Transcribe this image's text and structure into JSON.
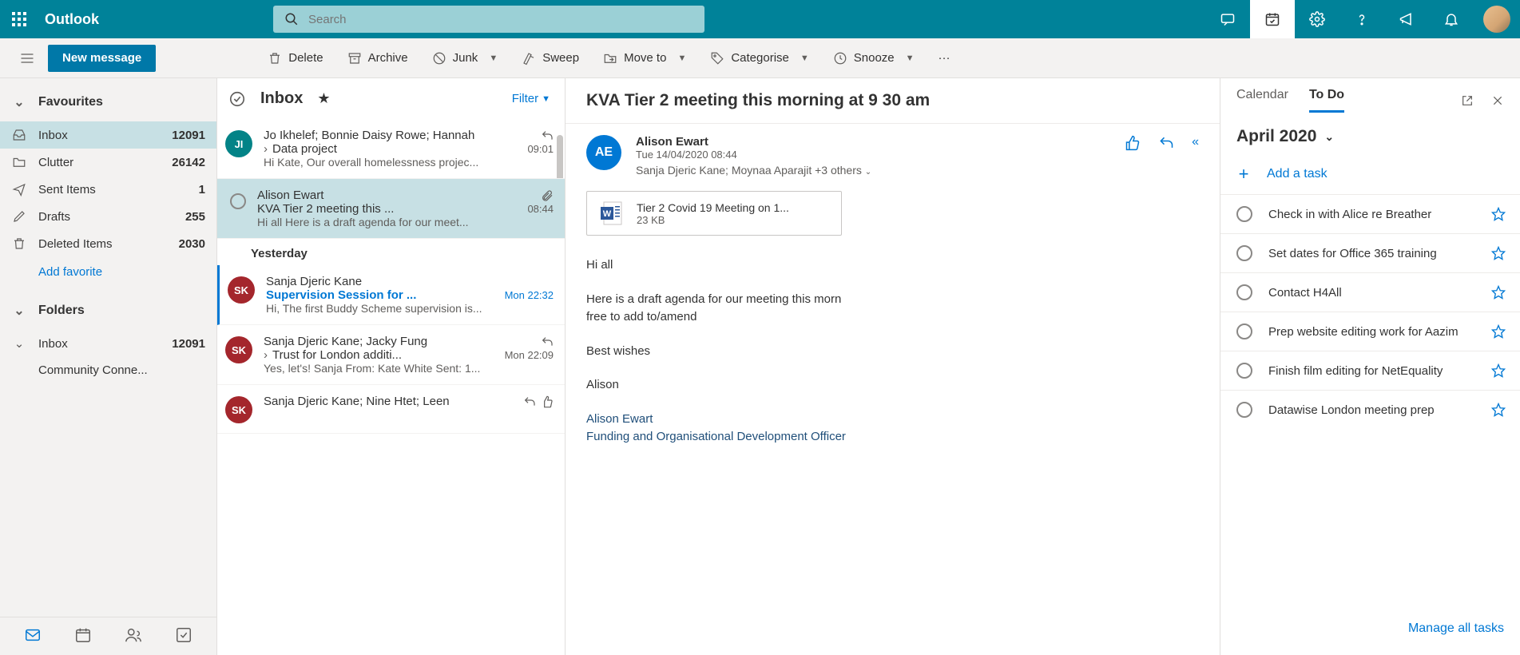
{
  "brand": "Outlook",
  "search": {
    "placeholder": "Search"
  },
  "newMessage": "New message",
  "cmdbar": {
    "delete": "Delete",
    "archive": "Archive",
    "junk": "Junk",
    "sweep": "Sweep",
    "moveTo": "Move to",
    "categorise": "Categorise",
    "snooze": "Snooze"
  },
  "nav": {
    "favourites": "Favourites",
    "folders": "Folders",
    "items": [
      {
        "label": "Inbox",
        "count": "12091"
      },
      {
        "label": "Clutter",
        "count": "26142"
      },
      {
        "label": "Sent Items",
        "count": "1"
      },
      {
        "label": "Drafts",
        "count": "255"
      },
      {
        "label": "Deleted Items",
        "count": "2030"
      }
    ],
    "addFavorite": "Add favorite",
    "inbox2": {
      "label": "Inbox",
      "count": "12091"
    },
    "community": "Community Conne..."
  },
  "list": {
    "title": "Inbox",
    "filter": "Filter",
    "yesterday": "Yesterday",
    "messages": [
      {
        "from": "Jo Ikhelef; Bonnie Daisy Rowe; Hannah",
        "subject": "Data project",
        "time": "09:01",
        "preview": "Hi Kate, Our overall homelessness projec...",
        "thread": true,
        "reply": true,
        "initials": "JI",
        "color": "#038387"
      },
      {
        "from": "Alison Ewart",
        "subject": "KVA Tier 2 meeting this ...",
        "time": "08:44",
        "preview": "Hi all Here is a draft agenda for our meet...",
        "attach": true,
        "selected": true
      },
      {
        "from": "Sanja Djeric Kane",
        "subject": "Supervision Session for ...",
        "time": "Mon 22:32",
        "preview": "Hi, The first Buddy Scheme supervision is...",
        "unread": true,
        "initials": "SK",
        "color": "#a4262c"
      },
      {
        "from": "Sanja Djeric Kane; Jacky Fung",
        "subject": "Trust for London additi...",
        "time": "Mon 22:09",
        "preview": "Yes, let's! Sanja From: Kate White Sent: 1...",
        "thread": true,
        "reply": true,
        "initials": "SK",
        "color": "#a4262c"
      },
      {
        "from": "Sanja Djeric Kane; Nine Htet; Leen",
        "subject": "",
        "time": "",
        "preview": "",
        "reply": true,
        "like": true,
        "initials": "SK",
        "color": "#a4262c",
        "partial": true
      }
    ]
  },
  "reading": {
    "subject": "KVA Tier 2 meeting this morning at 9 30 am",
    "fromName": "Alison Ewart",
    "fromInitials": "AE",
    "date": "Tue 14/04/2020 08:44",
    "to": "Sanja Djeric Kane; Moynaa Aparajit +3 others",
    "attachment": {
      "name": "Tier 2 Covid 19 Meeting on 1...",
      "size": "23 KB"
    },
    "body": {
      "greeting": "Hi all",
      "line1": "Here is a draft agenda for our meeting this morn",
      "line2": "free to add to/amend",
      "closing": "Best wishes",
      "name": "Alison",
      "sigName": "Alison Ewart",
      "sigTitle": "Funding and Organisational Development Officer"
    }
  },
  "todo": {
    "tabs": {
      "calendar": "Calendar",
      "todo": "To Do"
    },
    "month": "April 2020",
    "addTask": "Add a task",
    "tasks": [
      "Check in with Alice re Breather",
      "Set dates for Office 365 training",
      "Contact H4All",
      "Prep website editing work for Aazim",
      "Finish film editing for NetEquality",
      "Datawise London meeting prep"
    ],
    "manage": "Manage all tasks"
  }
}
